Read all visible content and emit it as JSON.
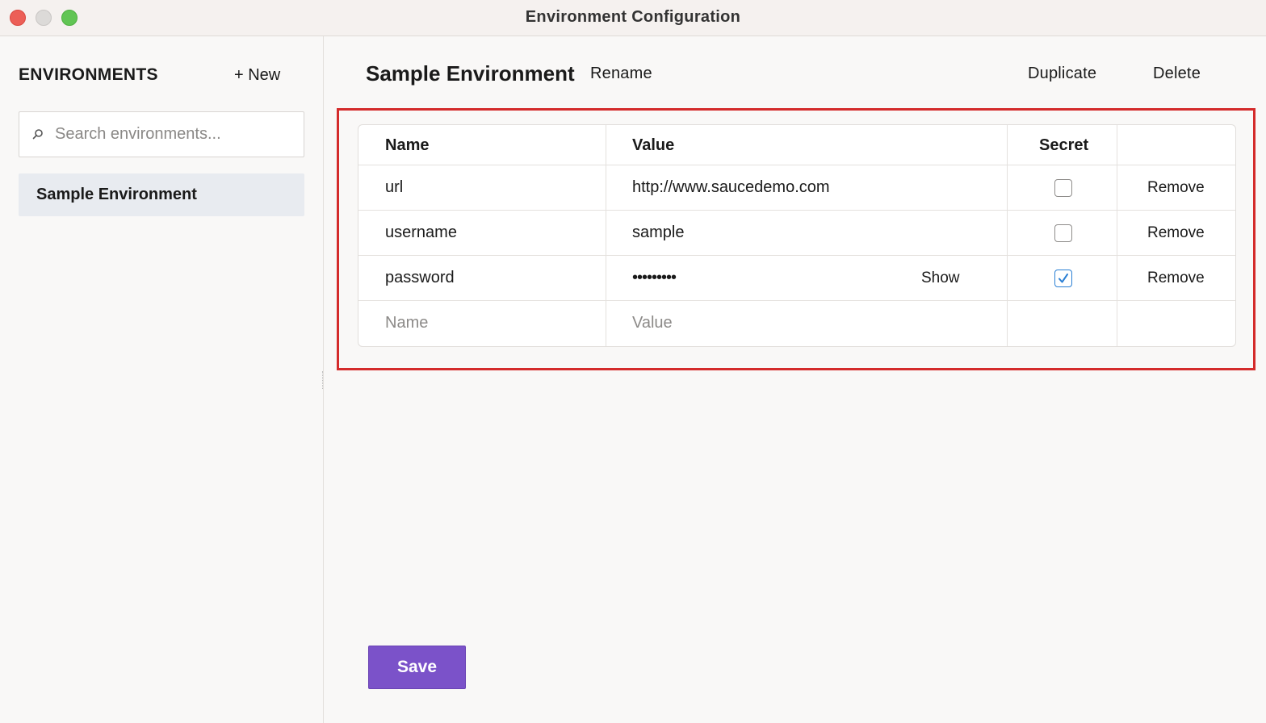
{
  "window": {
    "title": "Environment Configuration"
  },
  "sidebar": {
    "heading": "ENVIRONMENTS",
    "new_label": "+ New",
    "search": {
      "placeholder": "Search environments...",
      "value": ""
    },
    "items": [
      {
        "label": "Sample Environment",
        "selected": true
      }
    ]
  },
  "main": {
    "title": "Sample Environment",
    "rename_label": "Rename",
    "duplicate_label": "Duplicate",
    "delete_label": "Delete",
    "table": {
      "columns": [
        "Name",
        "Value",
        "Secret"
      ],
      "rows": [
        {
          "name": "url",
          "value": "http://www.saucedemo.com",
          "secret": false,
          "remove_label": "Remove"
        },
        {
          "name": "username",
          "value": "sample",
          "secret": false,
          "remove_label": "Remove"
        },
        {
          "name": "password",
          "value": "•••••••••",
          "secret": true,
          "show_label": "Show",
          "remove_label": "Remove"
        }
      ],
      "new_row": {
        "name_placeholder": "Name",
        "value_placeholder": "Value"
      }
    },
    "save_label": "Save"
  },
  "colors": {
    "accent": "#7b52c9",
    "highlight_border": "#d42b2b",
    "checkbox_checked": "#2a7fd4",
    "selected_item_bg": "#e8ebf0"
  }
}
